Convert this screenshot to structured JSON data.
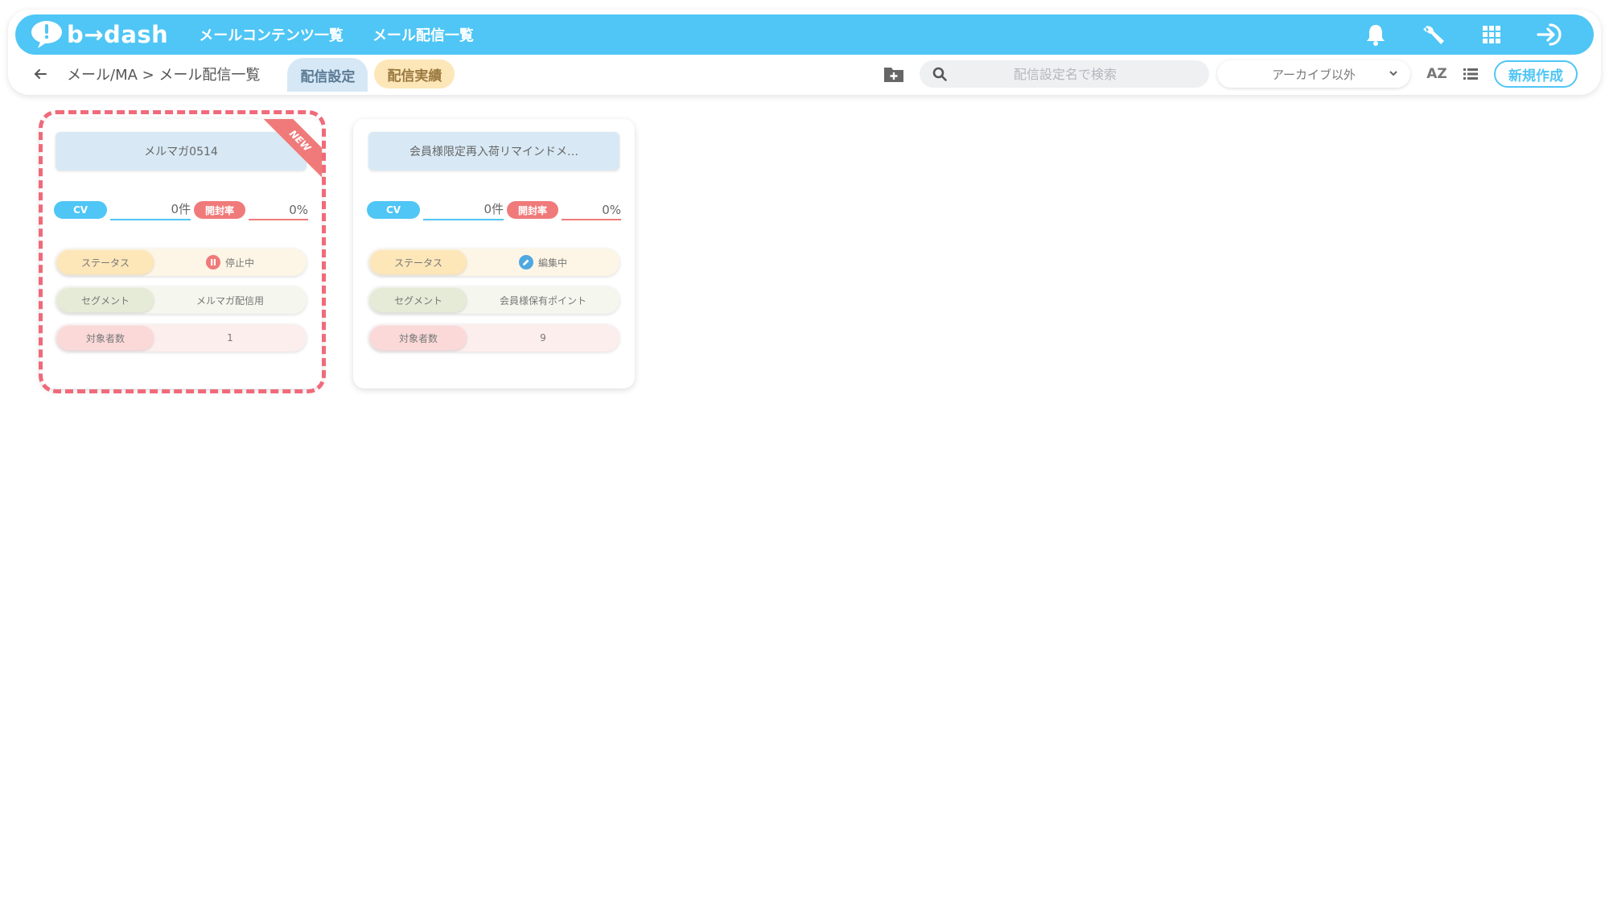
{
  "header": {
    "logo_text": "b→dash",
    "nav": [
      "メールコンテンツ一覧",
      "メール配信一覧"
    ]
  },
  "subbar": {
    "breadcrumb": "メール/MA > メール配信一覧",
    "tabs": [
      {
        "label": "配信設定",
        "active": true
      },
      {
        "label": "配信実績",
        "active": false
      }
    ],
    "search_placeholder": "配信設定名で検索",
    "filter_value": "アーカイブ以外",
    "sort_label": "AZ",
    "new_button": "新規作成"
  },
  "cards": [
    {
      "title": "メルマガ0514",
      "badge": "NEW",
      "cv_label": "CV",
      "cv_value": "0件",
      "open_label": "開封率",
      "open_value": "0%",
      "status_label": "ステータス",
      "status_value": "停止中",
      "status_icon": "pause-icon",
      "segment_label": "セグメント",
      "segment_value": "メルマガ配信用",
      "count_label": "対象者数",
      "count_value": "1"
    },
    {
      "title": "会員様限定再入荷リマインドメ…",
      "cv_label": "CV",
      "cv_value": "0件",
      "open_label": "開封率",
      "open_value": "0%",
      "status_label": "ステータス",
      "status_value": "編集中",
      "status_icon": "pencil-icon",
      "segment_label": "セグメント",
      "segment_value": "会員様保有ポイント",
      "count_label": "対象者数",
      "count_value": "9"
    }
  ],
  "colors": {
    "primary": "#4fc6f5",
    "accent_red": "#f07a7a",
    "highlight": "#f06a7a"
  }
}
